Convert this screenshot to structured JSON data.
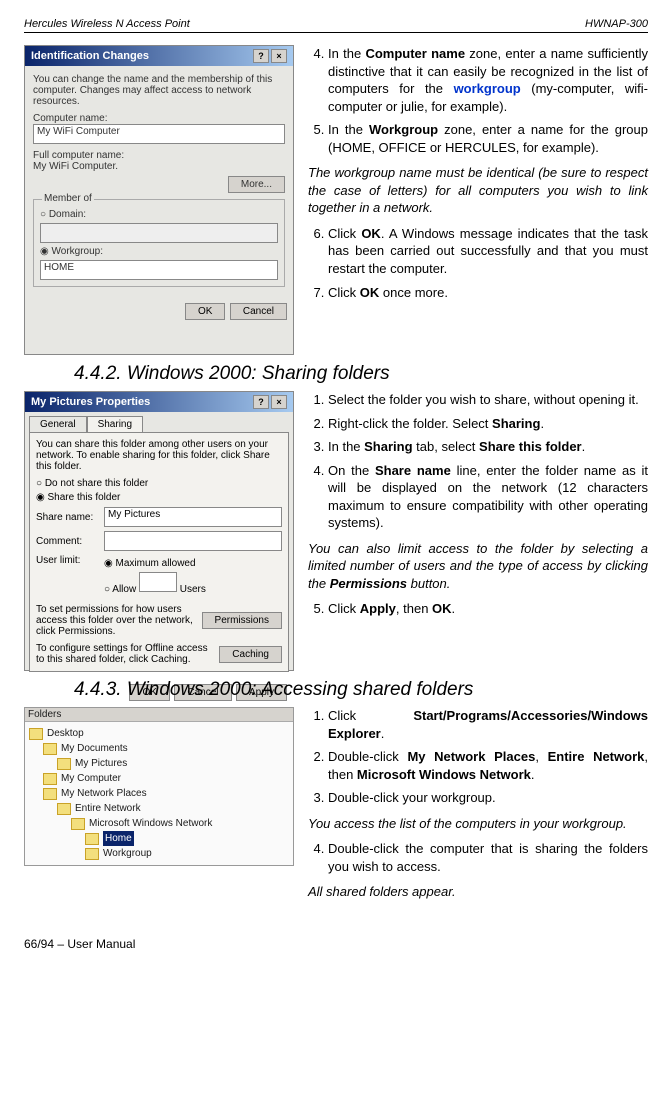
{
  "header": {
    "left": "Hercules Wireless N Access Point",
    "right": "HWNAP-300"
  },
  "dialog1": {
    "title": "Identification Changes",
    "intro": "You can change the name and the membership of this computer. Changes may affect access to network resources.",
    "label_computer_name": "Computer name:",
    "value_computer_name": "My WiFi Computer",
    "label_full_name": "Full computer name:",
    "value_full_name": "My WiFi Computer.",
    "btn_more": "More...",
    "group_label": "Member of",
    "radio_domain": "Domain:",
    "radio_workgroup": "Workgroup:",
    "workgroup_value": "HOME",
    "btn_ok": "OK",
    "btn_cancel": "Cancel"
  },
  "col1": {
    "li4": "In the ",
    "li4b": "Computer name",
    "li4c": " zone, enter a name sufficiently distinctive that it can easily be recognized in the list of computers for the ",
    "li4d": "workgroup",
    "li4e": " (my-computer, wifi-computer or julie, for example).",
    "li5": "In the ",
    "li5b": "Workgroup",
    "li5c": " zone, enter a name for the group (HOME, OFFICE or HERCULES, for example).",
    "note": "The workgroup name must be identical (be sure to respect the case of letters) for all computers you wish to link together in a network.",
    "li6a": "Click ",
    "li6b": "OK",
    "li6c": ".  A Windows message indicates that the task has been carried out successfully and that you must restart the computer.",
    "li7a": "Click ",
    "li7b": "OK",
    "li7c": " once more."
  },
  "heading2": "4.4.2. Windows 2000: Sharing folders",
  "dialog2": {
    "title": "My Pictures Properties",
    "tab_general": "General",
    "tab_sharing": "Sharing",
    "intro": "You can share this folder among other users on your network. To enable sharing for this folder, click Share this folder.",
    "r1": "Do not share this folder",
    "r2": "Share this folder",
    "lbl_share": "Share name:",
    "val_share": "My Pictures",
    "lbl_comment": "Comment:",
    "lbl_limit": "User limit:",
    "r_max": "Maximum allowed",
    "r_allow": "Allow",
    "users": "Users",
    "perm_txt": "To set permissions for how users access this folder over the network, click Permissions.",
    "btn_perm": "Permissions",
    "cache_txt": "To configure settings for Offline access to this shared folder, click Caching.",
    "btn_cache": "Caching",
    "btn_ok": "OK",
    "btn_cancel": "Cancel",
    "btn_apply": "Apply"
  },
  "col2": {
    "li1": "Select the folder you wish to share, without opening it.",
    "li2a": "Right-click the folder.  Select ",
    "li2b": "Sharing",
    "li2c": ".",
    "li3a": "In the ",
    "li3b": "Sharing",
    "li3c": " tab, select ",
    "li3d": "Share this folder",
    "li3e": ".",
    "li4a": "On the ",
    "li4b": "Share name",
    "li4c": " line, enter the folder name as it will be displayed on the network (12 characters maximum to ensure compatibility with other operating systems).",
    "note1": "You can also limit access to the folder by selecting a limited number of users and the type of access by clicking the ",
    "note1b": "Permissions",
    "note1c": " button.",
    "li5a": "Click ",
    "li5b": "Apply",
    "li5c": ", then ",
    "li5d": "OK",
    "li5e": "."
  },
  "heading3": "4.4.3.  Windows 2000: Accessing shared folders",
  "tree": {
    "hdr": "Folders",
    "i1": "Desktop",
    "i2": "My Documents",
    "i3": "My Pictures",
    "i4": "My Computer",
    "i5": "My Network Places",
    "i6": "Entire Network",
    "i7": "Microsoft Windows Network",
    "i8": "Home",
    "i9": "Workgroup"
  },
  "col3": {
    "li1a": "Click ",
    "li1b": "Start/Programs/Accessories/Windows Explorer",
    "li1c": ".",
    "li2a": "Double-click ",
    "li2b": "My Network Places",
    "li2c": ", ",
    "li2d": "Entire Network",
    "li2e": ", then ",
    "li2f": "Microsoft Windows Network",
    "li2g": ".",
    "li3": "Double-click your workgroup.",
    "note": "You access the list of the computers in your workgroup.",
    "li4": "Double-click the computer that is sharing the folders you wish to access.",
    "endnote": "All shared folders appear."
  },
  "footer": "66/94 – User Manual"
}
